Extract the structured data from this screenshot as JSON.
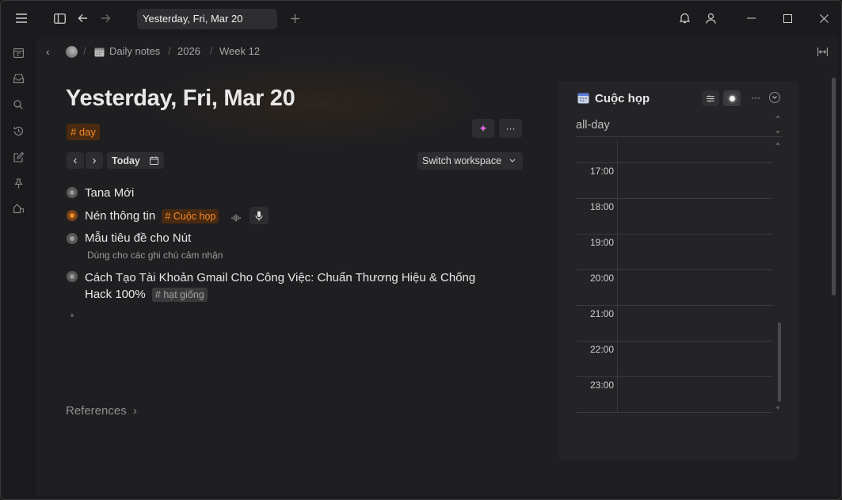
{
  "tab": {
    "title": "Yesterday, Fri, Mar 20"
  },
  "breadcrumb": {
    "items": [
      "Daily notes",
      "2026",
      "Week 12"
    ],
    "separator": "/"
  },
  "page": {
    "title": "Yesterday, Fri, Mar 20",
    "tag": "day",
    "today_label": "Today",
    "switch_workspace": "Switch workspace"
  },
  "nodes": [
    {
      "text": "Tana Mới"
    },
    {
      "text": "Nén thông tin",
      "tag": "Cuộc họp"
    },
    {
      "text": "Mẫu tiêu đề cho Nút",
      "description": "Dùng cho các ghi chú cảm nhận"
    },
    {
      "line1": "Cách Tạo Tài Khoản Gmail Cho Công Việc: Chuẩn Thương Hiệu & Chống",
      "line2": "Hack 100%",
      "tag": "hạt giống"
    }
  ],
  "references": {
    "label": "References"
  },
  "calendar": {
    "title": "Cuộc họp",
    "all_day": "all-day",
    "hours": [
      "17:00",
      "18:00",
      "19:00",
      "20:00",
      "21:00",
      "22:00",
      "23:00"
    ]
  },
  "icons": {
    "hash": "#",
    "more": "···",
    "sparkle": "✦",
    "chevron_right": "›",
    "chevron_left": "‹",
    "chevron_down": "⌄"
  },
  "colors": {
    "accent_orange": "#f08a2c",
    "tag_bg": "#4a2a10"
  }
}
